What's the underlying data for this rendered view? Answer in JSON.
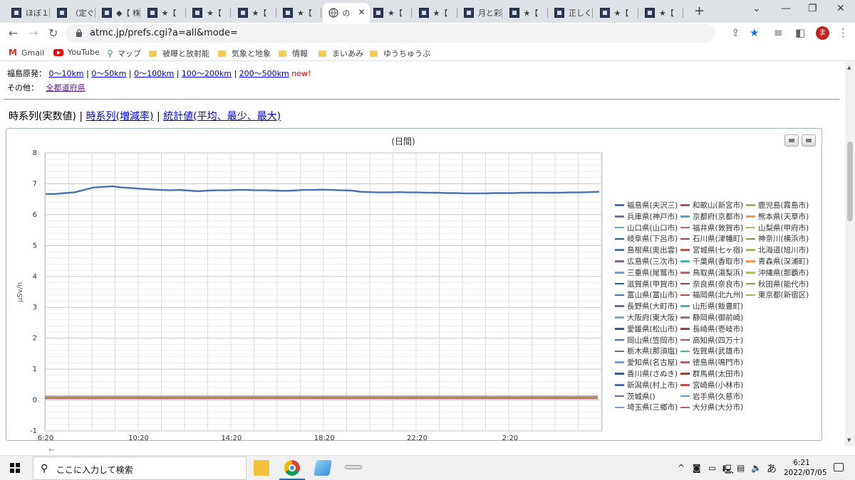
{
  "browser": {
    "tabs": [
      {
        "label": "ほぼ１"
      },
      {
        "label": "（定ぐ"
      },
      {
        "label": "◆【 株"
      },
      {
        "label": "★【"
      },
      {
        "label": "★【"
      },
      {
        "label": "★【"
      },
      {
        "label": "★【"
      },
      {
        "label": "の",
        "active": true
      },
      {
        "label": "★【"
      },
      {
        "label": "★【"
      },
      {
        "label": "月と彩"
      },
      {
        "label": "★【"
      },
      {
        "label": "正しく"
      },
      {
        "label": "★【"
      },
      {
        "label": "★【"
      }
    ],
    "new_tab": "+",
    "url": "atmc.jp/prefs.cgi?a=all&mode=",
    "avatar_letter": "ま",
    "bookmarks": [
      {
        "label": "Gmail",
        "icon": "gmail-icon"
      },
      {
        "label": "YouTube",
        "icon": "youtube-icon"
      },
      {
        "label": "マップ",
        "icon": "maps-pin-icon"
      },
      {
        "label": "被曝と放射能",
        "icon": "folder-icon"
      },
      {
        "label": "気象と地象",
        "icon": "folder-icon"
      },
      {
        "label": "情報",
        "icon": "folder-icon"
      },
      {
        "label": "まいあみ",
        "icon": "folder-icon"
      },
      {
        "label": "ゆうちゅうぶ",
        "icon": "folder-icon"
      }
    ]
  },
  "page": {
    "fukushima_label": "福島原発：",
    "fukushima_links": [
      "0～10km",
      "0～50km",
      "0～100km",
      "100～200km",
      "200～500km"
    ],
    "new_badge": "new!",
    "other_label": "その他：",
    "other_link": "全都道府県",
    "chart_modes": {
      "current": "時系列(実数値)",
      "links": [
        "時系列(増減率)",
        "統計値(平均、最少、最大)"
      ],
      "separator": "|"
    }
  },
  "chart_data": {
    "type": "line",
    "title": "(日間)",
    "ylabel": "μSv/h",
    "ylim": [
      -1,
      8
    ],
    "yticks": [
      -1,
      0,
      1,
      2,
      3,
      4,
      5,
      6,
      7,
      8
    ],
    "xticks": [
      "6:20",
      "10:20",
      "14:20",
      "18:20",
      "22:20",
      "2:20"
    ],
    "series": [
      {
        "name": "福島県(夫沢三)",
        "color": "#4a72b0",
        "values": [
          6.67,
          6.67,
          6.7,
          6.72,
          6.8,
          6.88,
          6.9,
          6.92,
          6.88,
          6.86,
          6.84,
          6.82,
          6.8,
          6.79,
          6.8,
          6.78,
          6.76,
          6.78,
          6.79,
          6.79,
          6.8,
          6.8,
          6.79,
          6.79,
          6.78,
          6.77,
          6.78,
          6.8,
          6.8,
          6.81,
          6.8,
          6.79,
          6.78,
          6.74,
          6.73,
          6.72,
          6.72,
          6.73,
          6.72,
          6.72,
          6.71,
          6.71,
          6.7,
          6.7,
          6.69,
          6.69,
          6.69,
          6.7,
          6.7,
          6.7,
          6.71,
          6.71,
          6.71,
          6.71,
          6.71,
          6.72,
          6.72,
          6.73,
          6.74
        ]
      },
      {
        "name": "和歌山(新宮市)",
        "color": "#c0504d",
        "values": [
          0.08,
          0.08
        ]
      },
      {
        "name": "鹿児島(霧島市)",
        "color": "#9bbb59",
        "values": [
          0.08,
          0.08
        ]
      }
    ],
    "legend": {
      "placement": "right",
      "columns": [
        [
          "福島県(夫沢三)",
          "兵庫県(神戸市)",
          "山口県(山口市)",
          "岐阜県(下呂市)",
          "島根県(奥出雲)",
          "広島県(三次市)",
          "三重県(尾鷲市)",
          "滋賀県(甲賀市)",
          "富山県(富山市)",
          "長野県(大町市)",
          "大阪府(東大阪)",
          "愛媛県(松山市)",
          "岡山県(笠岡市)",
          "栃木県(那須塩)",
          "愛知県(名古屋)",
          "香川県(さぬき)",
          "新潟県(村上市)",
          "茨城県()",
          "埼玉県(三郷市)"
        ],
        [
          "和歌山(新宮市)",
          "京都府(京都市)",
          "福井県(敦賀市)",
          "石川県(津幡町)",
          "宮城県(七ヶ宿)",
          "千葉県(香取市)",
          "鳥取県(湯梨浜)",
          "奈良県(奈良市)",
          "福岡県(北九州)",
          "山形県(飯豊町)",
          "静岡県(御前崎)",
          "長崎県(壱岐市)",
          "高知県(四万十)",
          "佐賀県(武雄市)",
          "徳島県(鳴門市)",
          "群馬県(太田市)",
          "宮崎県(小林市)",
          "岩手県(久慈市)",
          "大分県(大分市)"
        ],
        [
          "鹿児島(霧島市)",
          "熊本県(天草市)",
          "山梨県(甲府市)",
          "神奈川(横浜市)",
          "北海道(旭川市)",
          "青森県(深浦町)",
          "沖縄県(那覇市)",
          "秋田県(能代市)",
          "東京都(新宿区)"
        ]
      ],
      "colors": [
        "#4a72b0",
        "#c0504d",
        "#9bbb59",
        "#8064a2",
        "#4bacc6",
        "#f79646",
        "#7f9fd0",
        "#b46462",
        "#a6c36b",
        "#2c5d8f",
        "#9e403d",
        "#7aa13e"
      ]
    }
  },
  "taskbar": {
    "search_placeholder": "ここに入力して検索",
    "time": "6:21",
    "date": "2022/07/05",
    "ime": "あ",
    "tray_arrow": "^"
  }
}
